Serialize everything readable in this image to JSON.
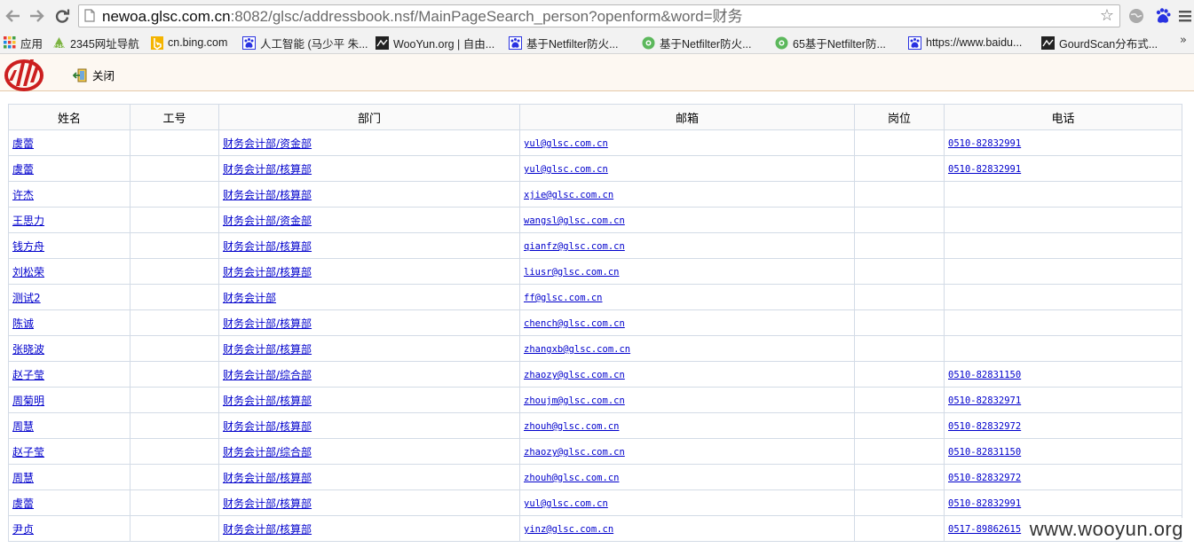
{
  "browser": {
    "url_scheme_host": "newoa.glsc.com.cn",
    "url_rest": ":8082/glsc/addressbook.nsf/MainPageSearch_person?openform&word=财务",
    "bookmarks": [
      {
        "label": "应用",
        "icon": "apps-grid-icon"
      },
      {
        "label": "2345网址导航",
        "icon": "2345-site-icon"
      },
      {
        "label": "cn.bing.com",
        "icon": "bing-icon"
      },
      {
        "label": "人工智能 (马少平 朱...",
        "icon": "baidu-paw-icon"
      },
      {
        "label": "WooYun.org | 自由...",
        "icon": "wooyun-icon"
      },
      {
        "label": "基于Netfilter防火...",
        "icon": "baidu-paw-icon"
      },
      {
        "label": "基于Netfilter防火...",
        "icon": "green-circle-icon"
      },
      {
        "label": "65基于Netfilter防...",
        "icon": "green-circle-icon"
      },
      {
        "label": "https://www.baidu...",
        "icon": "baidu-paw-icon"
      },
      {
        "label": "GourdScan分布式...",
        "icon": "wooyun-icon"
      }
    ],
    "more_label": "»"
  },
  "page": {
    "close_label": "关闭"
  },
  "table": {
    "headers": [
      "姓名",
      "工号",
      "部门",
      "邮箱",
      "岗位",
      "电话"
    ],
    "rows": [
      {
        "name": "虞蕾",
        "id": "",
        "dept": "财务会计部/资金部",
        "email": "yul@glsc.com.cn",
        "post": "",
        "phone": "0510-82832991"
      },
      {
        "name": "虞蕾",
        "id": "",
        "dept": "财务会计部/核算部",
        "email": "yul@glsc.com.cn",
        "post": "",
        "phone": "0510-82832991"
      },
      {
        "name": "许杰",
        "id": "",
        "dept": "财务会计部/核算部",
        "email": "xjie@glsc.com.cn",
        "post": "",
        "phone": ""
      },
      {
        "name": "王思力",
        "id": "",
        "dept": "财务会计部/资金部",
        "email": "wangsl@glsc.com.cn",
        "post": "",
        "phone": ""
      },
      {
        "name": "钱方舟",
        "id": "",
        "dept": "财务会计部/核算部",
        "email": "qianfz@glsc.com.cn",
        "post": "",
        "phone": ""
      },
      {
        "name": "刘松荣",
        "id": "",
        "dept": "财务会计部/核算部",
        "email": "liusr@glsc.com.cn",
        "post": "",
        "phone": ""
      },
      {
        "name": "测试2",
        "id": "",
        "dept": "财务会计部",
        "email": "ff@glsc.com.cn",
        "post": "",
        "phone": ""
      },
      {
        "name": "陈诚",
        "id": "",
        "dept": "财务会计部/核算部",
        "email": "chench@glsc.com.cn",
        "post": "",
        "phone": ""
      },
      {
        "name": "张晓波",
        "id": "",
        "dept": "财务会计部/核算部",
        "email": "zhangxb@glsc.com.cn",
        "post": "",
        "phone": ""
      },
      {
        "name": "赵子莹",
        "id": "",
        "dept": "财务会计部/综合部",
        "email": "zhaozy@glsc.com.cn",
        "post": "",
        "phone": "0510-82831150"
      },
      {
        "name": "周菊明",
        "id": "",
        "dept": "财务会计部/核算部",
        "email": "zhoujm@glsc.com.cn",
        "post": "",
        "phone": "0510-82832971"
      },
      {
        "name": "周慧",
        "id": "",
        "dept": "财务会计部/核算部",
        "email": "zhouh@glsc.com.cn",
        "post": "",
        "phone": "0510-82832972"
      },
      {
        "name": "赵子莹",
        "id": "",
        "dept": "财务会计部/综合部",
        "email": "zhaozy@glsc.com.cn",
        "post": "",
        "phone": "0510-82831150"
      },
      {
        "name": "周慧",
        "id": "",
        "dept": "财务会计部/核算部",
        "email": "zhouh@glsc.com.cn",
        "post": "",
        "phone": "0510-82832972"
      },
      {
        "name": "虞蕾",
        "id": "",
        "dept": "财务会计部/核算部",
        "email": "yul@glsc.com.cn",
        "post": "",
        "phone": "0510-82832991"
      },
      {
        "name": "尹贞",
        "id": "",
        "dept": "财务会计部/核算部",
        "email": "yinz@glsc.com.cn",
        "post": "",
        "phone": "0517-89862615"
      }
    ]
  },
  "watermark": "www.wooyun.org",
  "colors": {
    "link": "#0000cc",
    "logo_red": "#cc1f1f",
    "header_bg": "#fdf8f2"
  }
}
